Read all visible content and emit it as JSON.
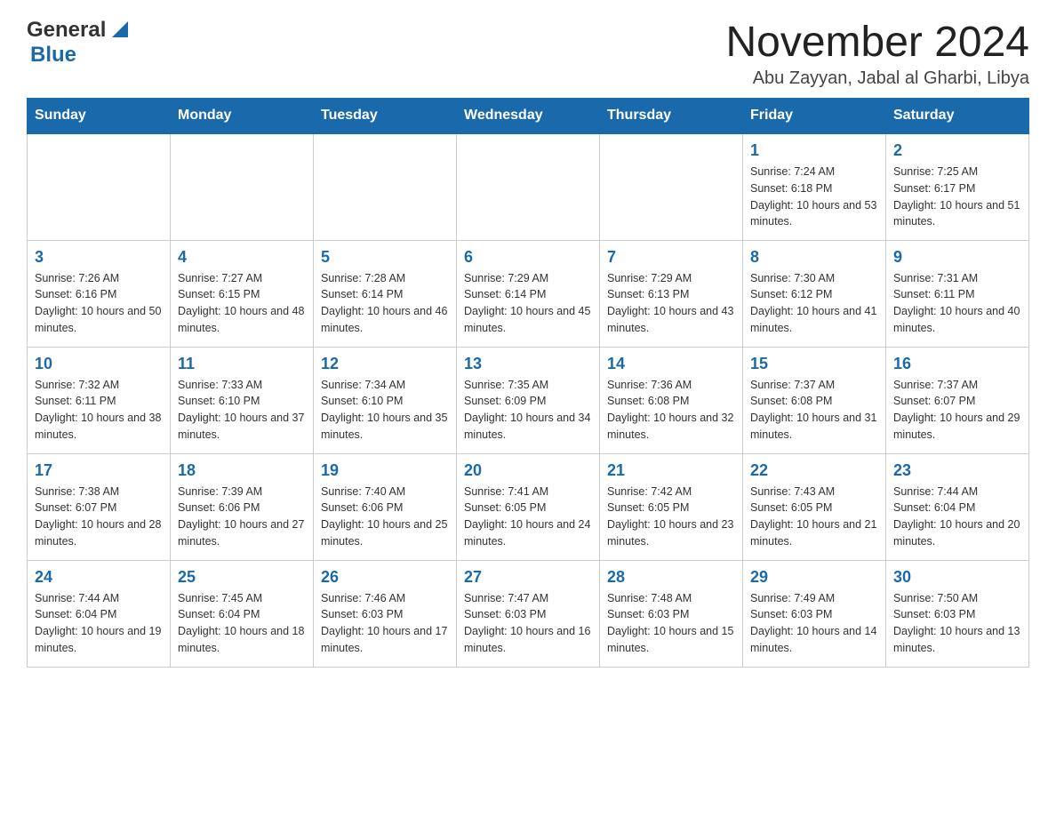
{
  "header": {
    "logo_general": "General",
    "logo_blue": "Blue",
    "month_title": "November 2024",
    "location": "Abu Zayyan, Jabal al Gharbi, Libya"
  },
  "weekdays": [
    "Sunday",
    "Monday",
    "Tuesday",
    "Wednesday",
    "Thursday",
    "Friday",
    "Saturday"
  ],
  "weeks": [
    [
      {
        "day": "",
        "info": ""
      },
      {
        "day": "",
        "info": ""
      },
      {
        "day": "",
        "info": ""
      },
      {
        "day": "",
        "info": ""
      },
      {
        "day": "",
        "info": ""
      },
      {
        "day": "1",
        "info": "Sunrise: 7:24 AM\nSunset: 6:18 PM\nDaylight: 10 hours and 53 minutes."
      },
      {
        "day": "2",
        "info": "Sunrise: 7:25 AM\nSunset: 6:17 PM\nDaylight: 10 hours and 51 minutes."
      }
    ],
    [
      {
        "day": "3",
        "info": "Sunrise: 7:26 AM\nSunset: 6:16 PM\nDaylight: 10 hours and 50 minutes."
      },
      {
        "day": "4",
        "info": "Sunrise: 7:27 AM\nSunset: 6:15 PM\nDaylight: 10 hours and 48 minutes."
      },
      {
        "day": "5",
        "info": "Sunrise: 7:28 AM\nSunset: 6:14 PM\nDaylight: 10 hours and 46 minutes."
      },
      {
        "day": "6",
        "info": "Sunrise: 7:29 AM\nSunset: 6:14 PM\nDaylight: 10 hours and 45 minutes."
      },
      {
        "day": "7",
        "info": "Sunrise: 7:29 AM\nSunset: 6:13 PM\nDaylight: 10 hours and 43 minutes."
      },
      {
        "day": "8",
        "info": "Sunrise: 7:30 AM\nSunset: 6:12 PM\nDaylight: 10 hours and 41 minutes."
      },
      {
        "day": "9",
        "info": "Sunrise: 7:31 AM\nSunset: 6:11 PM\nDaylight: 10 hours and 40 minutes."
      }
    ],
    [
      {
        "day": "10",
        "info": "Sunrise: 7:32 AM\nSunset: 6:11 PM\nDaylight: 10 hours and 38 minutes."
      },
      {
        "day": "11",
        "info": "Sunrise: 7:33 AM\nSunset: 6:10 PM\nDaylight: 10 hours and 37 minutes."
      },
      {
        "day": "12",
        "info": "Sunrise: 7:34 AM\nSunset: 6:10 PM\nDaylight: 10 hours and 35 minutes."
      },
      {
        "day": "13",
        "info": "Sunrise: 7:35 AM\nSunset: 6:09 PM\nDaylight: 10 hours and 34 minutes."
      },
      {
        "day": "14",
        "info": "Sunrise: 7:36 AM\nSunset: 6:08 PM\nDaylight: 10 hours and 32 minutes."
      },
      {
        "day": "15",
        "info": "Sunrise: 7:37 AM\nSunset: 6:08 PM\nDaylight: 10 hours and 31 minutes."
      },
      {
        "day": "16",
        "info": "Sunrise: 7:37 AM\nSunset: 6:07 PM\nDaylight: 10 hours and 29 minutes."
      }
    ],
    [
      {
        "day": "17",
        "info": "Sunrise: 7:38 AM\nSunset: 6:07 PM\nDaylight: 10 hours and 28 minutes."
      },
      {
        "day": "18",
        "info": "Sunrise: 7:39 AM\nSunset: 6:06 PM\nDaylight: 10 hours and 27 minutes."
      },
      {
        "day": "19",
        "info": "Sunrise: 7:40 AM\nSunset: 6:06 PM\nDaylight: 10 hours and 25 minutes."
      },
      {
        "day": "20",
        "info": "Sunrise: 7:41 AM\nSunset: 6:05 PM\nDaylight: 10 hours and 24 minutes."
      },
      {
        "day": "21",
        "info": "Sunrise: 7:42 AM\nSunset: 6:05 PM\nDaylight: 10 hours and 23 minutes."
      },
      {
        "day": "22",
        "info": "Sunrise: 7:43 AM\nSunset: 6:05 PM\nDaylight: 10 hours and 21 minutes."
      },
      {
        "day": "23",
        "info": "Sunrise: 7:44 AM\nSunset: 6:04 PM\nDaylight: 10 hours and 20 minutes."
      }
    ],
    [
      {
        "day": "24",
        "info": "Sunrise: 7:44 AM\nSunset: 6:04 PM\nDaylight: 10 hours and 19 minutes."
      },
      {
        "day": "25",
        "info": "Sunrise: 7:45 AM\nSunset: 6:04 PM\nDaylight: 10 hours and 18 minutes."
      },
      {
        "day": "26",
        "info": "Sunrise: 7:46 AM\nSunset: 6:03 PM\nDaylight: 10 hours and 17 minutes."
      },
      {
        "day": "27",
        "info": "Sunrise: 7:47 AM\nSunset: 6:03 PM\nDaylight: 10 hours and 16 minutes."
      },
      {
        "day": "28",
        "info": "Sunrise: 7:48 AM\nSunset: 6:03 PM\nDaylight: 10 hours and 15 minutes."
      },
      {
        "day": "29",
        "info": "Sunrise: 7:49 AM\nSunset: 6:03 PM\nDaylight: 10 hours and 14 minutes."
      },
      {
        "day": "30",
        "info": "Sunrise: 7:50 AM\nSunset: 6:03 PM\nDaylight: 10 hours and 13 minutes."
      }
    ]
  ]
}
